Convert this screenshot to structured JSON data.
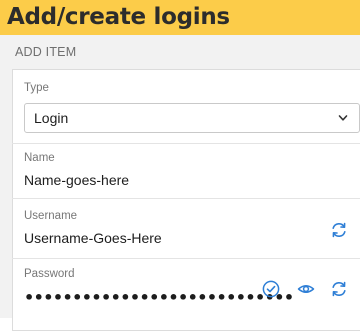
{
  "banner": {
    "title": "Add/create logins"
  },
  "section": {
    "header": "ADD ITEM"
  },
  "fields": {
    "type": {
      "label": "Type",
      "value": "Login"
    },
    "name": {
      "label": "Name",
      "value": "Name-goes-here"
    },
    "username": {
      "label": "Username",
      "value": "Username-Goes-Here"
    },
    "password": {
      "label": "Password",
      "value": "••••••••••••••••••••••••••••"
    }
  },
  "icons": {
    "select": "chevron-down-icon",
    "username_action": "refresh-icon",
    "password_actions": [
      "check-circle-icon",
      "eye-icon",
      "refresh-icon"
    ]
  },
  "colors": {
    "banner": "#fccc49",
    "icon_accent": "#2f7fd6"
  }
}
